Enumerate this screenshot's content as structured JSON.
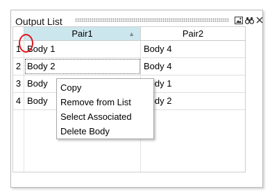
{
  "panel": {
    "title": "Output List",
    "toolbar_icons": [
      "image-icon",
      "binoculars-icon",
      "close-icon"
    ]
  },
  "table": {
    "columns": [
      "",
      "Pair1",
      "Pair2"
    ],
    "sorted_column": "Pair1",
    "sort_direction": "ascending",
    "rows": [
      {
        "num": "1",
        "pair1": "Body 1",
        "pair2": "Body 4"
      },
      {
        "num": "2",
        "pair1": "Body 2",
        "pair2": "Body 4"
      },
      {
        "num": "3",
        "pair1": "Body",
        "pair2": "Body 1"
      },
      {
        "num": "4",
        "pair1": "Body",
        "pair2": "Body 2"
      }
    ]
  },
  "context_menu": {
    "items": [
      "Copy",
      "Remove from List",
      "Select Associated",
      "Delete Body"
    ]
  },
  "colors": {
    "header_selected": "#cce6ee",
    "annotation_circle": "#e0161c"
  }
}
